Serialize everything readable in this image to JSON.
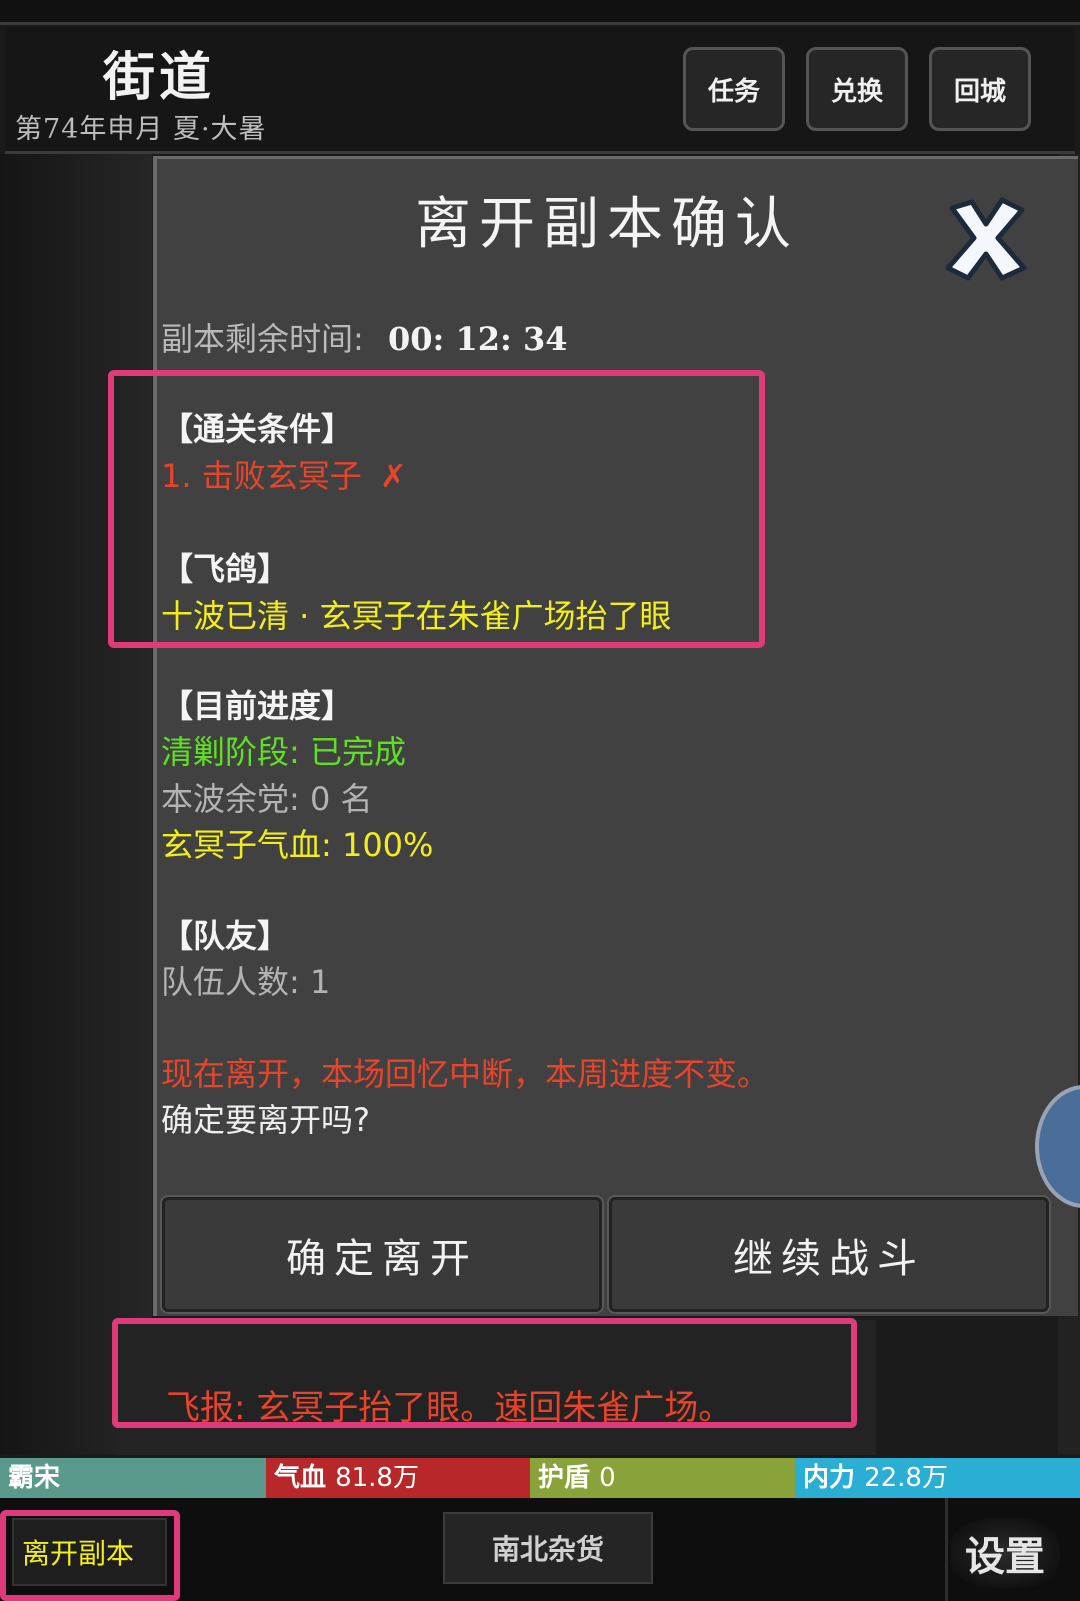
{
  "header": {
    "location": "街道",
    "date": "第74年申月  夏·大暑",
    "buttons": {
      "tasks": "任务",
      "exchange": "兑换",
      "return_city": "回城"
    }
  },
  "modal": {
    "title": "离开副本确认",
    "timer_label": "副本剩余时间:",
    "timer_value": "00: 12: 34",
    "clear_title": "【通关条件】",
    "clear_item": "1. 击败玄冥子",
    "clear_mark": "✗",
    "pigeon_title": "【飞鸽】",
    "pigeon_text": "十波已清 · 玄冥子在朱雀广场抬了眼",
    "progress_title": "【目前进度】",
    "progress_stage": "清剿阶段: 已完成",
    "progress_enemies": "本波余党: 0 名",
    "progress_boss_hp": "玄冥子气血: 100%",
    "team_title": "【队友】",
    "team_count": "队伍人数: 1",
    "warning": "现在离开，本场回忆中断，本周进度不变。",
    "confirm_question": "确定要离开吗?",
    "confirm_btn": "确定离开",
    "continue_btn": "继续战斗"
  },
  "news": {
    "text": "飞报: 玄冥子抬了眼。速回朱雀广场。"
  },
  "status": {
    "name": "霸宋",
    "hp_label": "气血",
    "hp_value": "81.8万",
    "shield_label": "护盾",
    "shield_value": "0",
    "mp_label": "内力",
    "mp_value": "22.8万",
    "colors": {
      "name": "#5a9a8c",
      "hp": "#b8282a",
      "shield": "#8aa23a",
      "mp": "#2aaed3"
    }
  },
  "bottom": {
    "leave_dungeon": "离开副本",
    "shop": "南北杂货",
    "settings": "设置"
  }
}
